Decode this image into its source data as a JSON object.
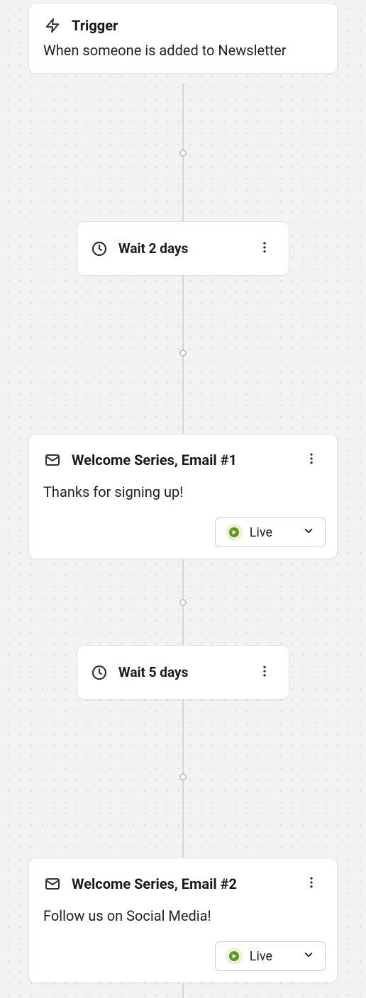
{
  "trigger": {
    "label": "Trigger",
    "description": "When someone is added to Newsletter"
  },
  "wait1": {
    "label": "Wait 2 days"
  },
  "email1": {
    "title": "Welcome Series, Email #1",
    "subject": "Thanks for signing up!",
    "status_label": "Live"
  },
  "wait2": {
    "label": "Wait 5 days"
  },
  "email2": {
    "title": "Welcome Series, Email #2",
    "subject": "Follow us on Social Media!",
    "status_label": "Live"
  }
}
